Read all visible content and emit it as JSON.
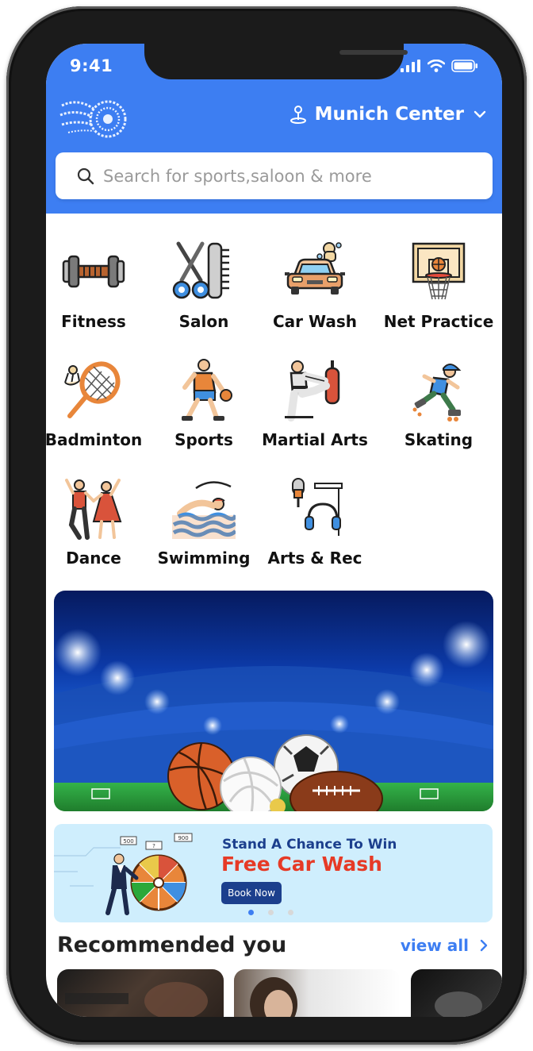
{
  "status_bar": {
    "time": "9:41"
  },
  "header": {
    "location": "Munich Center",
    "search_placeholder": "Search for sports,saloon & more"
  },
  "categories": [
    {
      "label": "Fitness",
      "icon": "dumbbell-icon"
    },
    {
      "label": "Salon",
      "icon": "scissors-comb-icon"
    },
    {
      "label": "Car Wash",
      "icon": "car-wash-icon"
    },
    {
      "label": "Net Practice",
      "icon": "basketball-hoop-icon"
    },
    {
      "label": "Badminton",
      "icon": "badminton-racket-icon"
    },
    {
      "label": "Sports",
      "icon": "basketball-player-icon"
    },
    {
      "label": "Martial Arts",
      "icon": "karate-kick-icon"
    },
    {
      "label": "Skating",
      "icon": "roller-skater-icon"
    },
    {
      "label": "Dance",
      "icon": "dancers-icon"
    },
    {
      "label": "Swimming",
      "icon": "swimmer-icon"
    },
    {
      "label": "Arts & Rec",
      "icon": "microphone-headphones-icon"
    }
  ],
  "promo": {
    "line1": "Stand A Chance To Win",
    "line2": "Free Car Wash",
    "button": "Book Now",
    "wheel_tags": [
      "500",
      "?",
      "900"
    ]
  },
  "carousel": {
    "pages": 3,
    "active": 1
  },
  "recommended": {
    "title": "Recommended you",
    "view_all": "view all"
  },
  "colors": {
    "primary": "#3d7ef2",
    "promo_red": "#e63a26",
    "promo_navy": "#1c3f8d"
  }
}
